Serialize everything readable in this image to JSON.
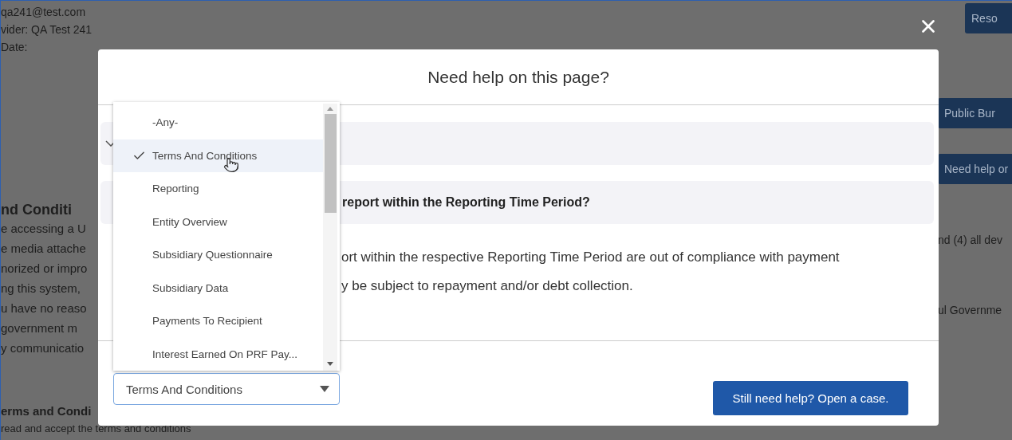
{
  "background_page": {
    "user_info": [
      "qa241@test.com",
      "vider: QA Test 241",
      "Date:"
    ],
    "section_heading": "nd Conditi",
    "paragraph_lines": [
      "e accessing a U",
      "e media attache",
      "norized or impro",
      "ng this system,",
      "u have no reaso",
      "government m",
      "y communicatio"
    ],
    "subheading": "erms and Condi",
    "footer_line": "read and accept the terms and conditions",
    "side_buttons": [
      "Reso",
      "Public Bur",
      "Need help or"
    ],
    "side_texts": [
      "nd (4) all dev",
      "ul Governme"
    ]
  },
  "dialog": {
    "title": "Need help on this page?",
    "faq_items": [
      {
        "expanded": false
      },
      {
        "question": "report within the Reporting Time Period?",
        "expanded": true,
        "answer_lines": [
          "ort within the respective Reporting Time Period are out of compliance with payment",
          "y be subject to repayment and/or debt collection."
        ]
      }
    ],
    "topic_select": {
      "value": "Terms And Conditions",
      "open": true,
      "options": [
        {
          "label": "-Any-",
          "selected": false
        },
        {
          "label": "Terms And Conditions",
          "selected": true
        },
        {
          "label": "Reporting",
          "selected": false
        },
        {
          "label": "Entity Overview",
          "selected": false
        },
        {
          "label": "Subsidiary Questionnaire",
          "selected": false
        },
        {
          "label": "Subsidiary Data",
          "selected": false
        },
        {
          "label": "Payments To Recipient",
          "selected": false
        },
        {
          "label": "Interest Earned On PRF Pay...",
          "selected": false
        }
      ]
    },
    "case_button": "Still need help? Open a case."
  }
}
